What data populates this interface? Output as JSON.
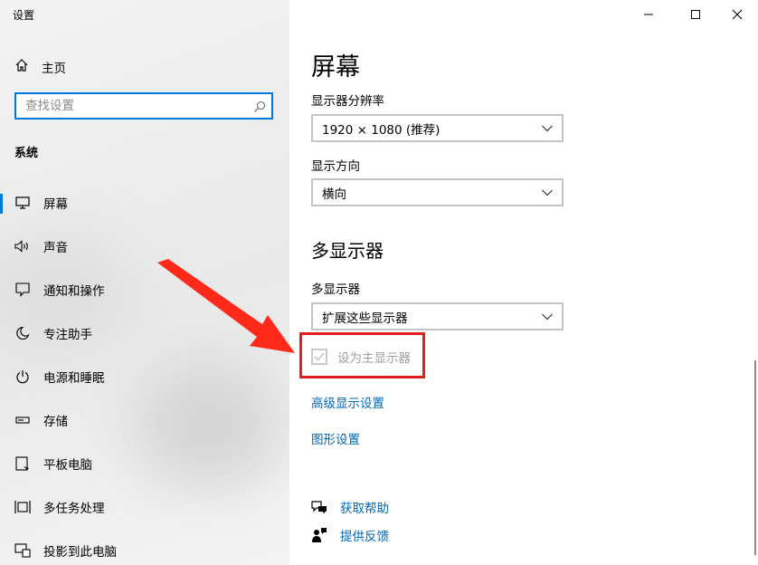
{
  "window": {
    "title": "设置"
  },
  "sidebar": {
    "home_label": "主页",
    "search_placeholder": "查找设置",
    "section_label": "系统",
    "items": [
      {
        "label": "屏幕",
        "icon": "monitor-icon",
        "active": true
      },
      {
        "label": "声音",
        "icon": "speaker-icon"
      },
      {
        "label": "通知和操作",
        "icon": "notification-icon"
      },
      {
        "label": "专注助手",
        "icon": "moon-icon"
      },
      {
        "label": "电源和睡眠",
        "icon": "power-icon"
      },
      {
        "label": "存储",
        "icon": "storage-icon"
      },
      {
        "label": "平板电脑",
        "icon": "tablet-icon"
      },
      {
        "label": "多任务处理",
        "icon": "multitask-icon"
      },
      {
        "label": "投影到此电脑",
        "icon": "project-icon"
      }
    ]
  },
  "main": {
    "page_title": "屏幕",
    "resolution": {
      "label": "显示器分辨率",
      "value": "1920 × 1080 (推荐)"
    },
    "orientation": {
      "label": "显示方向",
      "value": "横向"
    },
    "multi_display": {
      "section_title": "多显示器",
      "label": "多显示器",
      "value": "扩展这些显示器",
      "primary_checkbox_label": "设为主显示器",
      "primary_checked": true,
      "primary_disabled": true
    },
    "links": {
      "advanced": "高级显示设置",
      "graphics": "图形设置"
    },
    "help": {
      "get_help": "获取帮助",
      "feedback": "提供反馈"
    }
  },
  "annotation": {
    "box_color": "#e02020",
    "arrow_color": "#ff2a1a"
  },
  "accent_color": "#0078d7",
  "link_color": "#0067b8"
}
